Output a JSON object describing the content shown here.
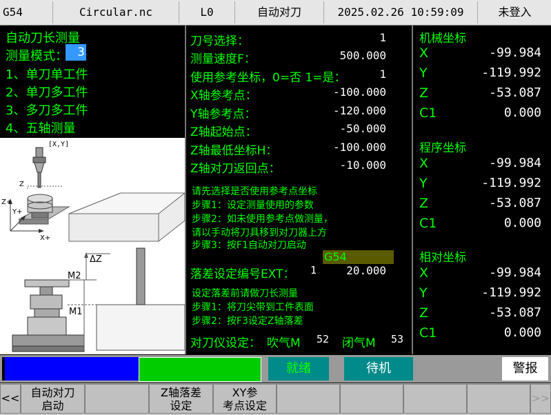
{
  "topbar": {
    "coord_system": "G54",
    "program_name": "Circular.nc",
    "level": "L0",
    "mode": "自动对刀",
    "datetime": "2025.02.26 10:59:09",
    "login": "未登入"
  },
  "left": {
    "title": "自动刀长测量",
    "mode_label": "测量模式：",
    "mode_value": "3",
    "options": [
      "1、单刀单工件",
      "2、单刀多工件",
      "3、多刀多工件",
      "4、五轴测量"
    ]
  },
  "diagram1": {
    "coord_label": "[X,Y]",
    "z_label": "Z",
    "zplus": "Z+",
    "yplus": "Y+",
    "xplus": "X+"
  },
  "diagram2": {
    "delta_z": "ΔZ",
    "m2": "M2",
    "m1": "M1"
  },
  "params": [
    {
      "label": "刀号选择：",
      "value": "1"
    },
    {
      "label": "测量速度F：",
      "value": "500.000"
    },
    {
      "label": "使用参考坐标，0=否 1=是：",
      "value": "1"
    },
    {
      "label": "X轴参考点：",
      "value": "-100.000"
    },
    {
      "label": "Y轴参考点：",
      "value": "-120.000"
    },
    {
      "label": "Z轴起始点：",
      "value": "-50.000"
    },
    {
      "label": "Z轴最低坐标H：",
      "value": "-100.000"
    },
    {
      "label": "Z轴对刀返回点：",
      "value": "-10.000"
    }
  ],
  "instructions1": [
    "请先选择是否使用参考点坐标",
    "步骤1：设定测量使用的参数",
    "步骤2：如未使用参考点做测量，",
    "请以手动将刀具移到对刀器上方",
    "步骤3：按F1自动对刀启动"
  ],
  "offset": {
    "highlight": "G54",
    "label": "落差设定编号EXT：",
    "ext_value": "1",
    "value": "20.000"
  },
  "instructions2": [
    "设定落差前请做刀长测量",
    "步骤1：将刀尖带到工件表面",
    "步骤2：按F3设定Z轴落差"
  ],
  "setter": {
    "label": "对刀仪设定：",
    "blow_label": "吹气M",
    "blow_value": "52",
    "close_label": "闭气M",
    "close_value": "53"
  },
  "coords": [
    {
      "title": "机械坐标",
      "axes": [
        {
          "axis": "X",
          "value": "-99.984"
        },
        {
          "axis": "Y",
          "value": "-119.992"
        },
        {
          "axis": "Z",
          "value": "-53.087"
        },
        {
          "axis": "C1",
          "value": "0.000"
        }
      ]
    },
    {
      "title": "程序坐标",
      "axes": [
        {
          "axis": "X",
          "value": "-99.984"
        },
        {
          "axis": "Y",
          "value": "-119.992"
        },
        {
          "axis": "Z",
          "value": "-53.087"
        },
        {
          "axis": "C1",
          "value": "0.000"
        }
      ]
    },
    {
      "title": "相对坐标",
      "axes": [
        {
          "axis": "X",
          "value": "-99.984"
        },
        {
          "axis": "Y",
          "value": "-119.992"
        },
        {
          "axis": "Z",
          "value": "-53.087"
        },
        {
          "axis": "C1",
          "value": "0.000"
        }
      ]
    }
  ],
  "status": {
    "ready": "就绪",
    "standby": "待机",
    "alarm": "警报"
  },
  "softkeys": {
    "prev": "<<",
    "f1_line1": "自动对刀",
    "f1_line2": "启动",
    "f3_line1": "Z轴落差",
    "f3_line2": "设定",
    "f4_line1": "XY参",
    "f4_line2": "考点设定",
    "next": ">>"
  },
  "colors": {
    "label_green": "#00ff00",
    "value_white": "#ffffff",
    "offset_highlight_bg": "#5a5a00",
    "status_teal": "#008a8a",
    "progress_blue": "#0000ff",
    "progress_green": "#00cc00"
  }
}
